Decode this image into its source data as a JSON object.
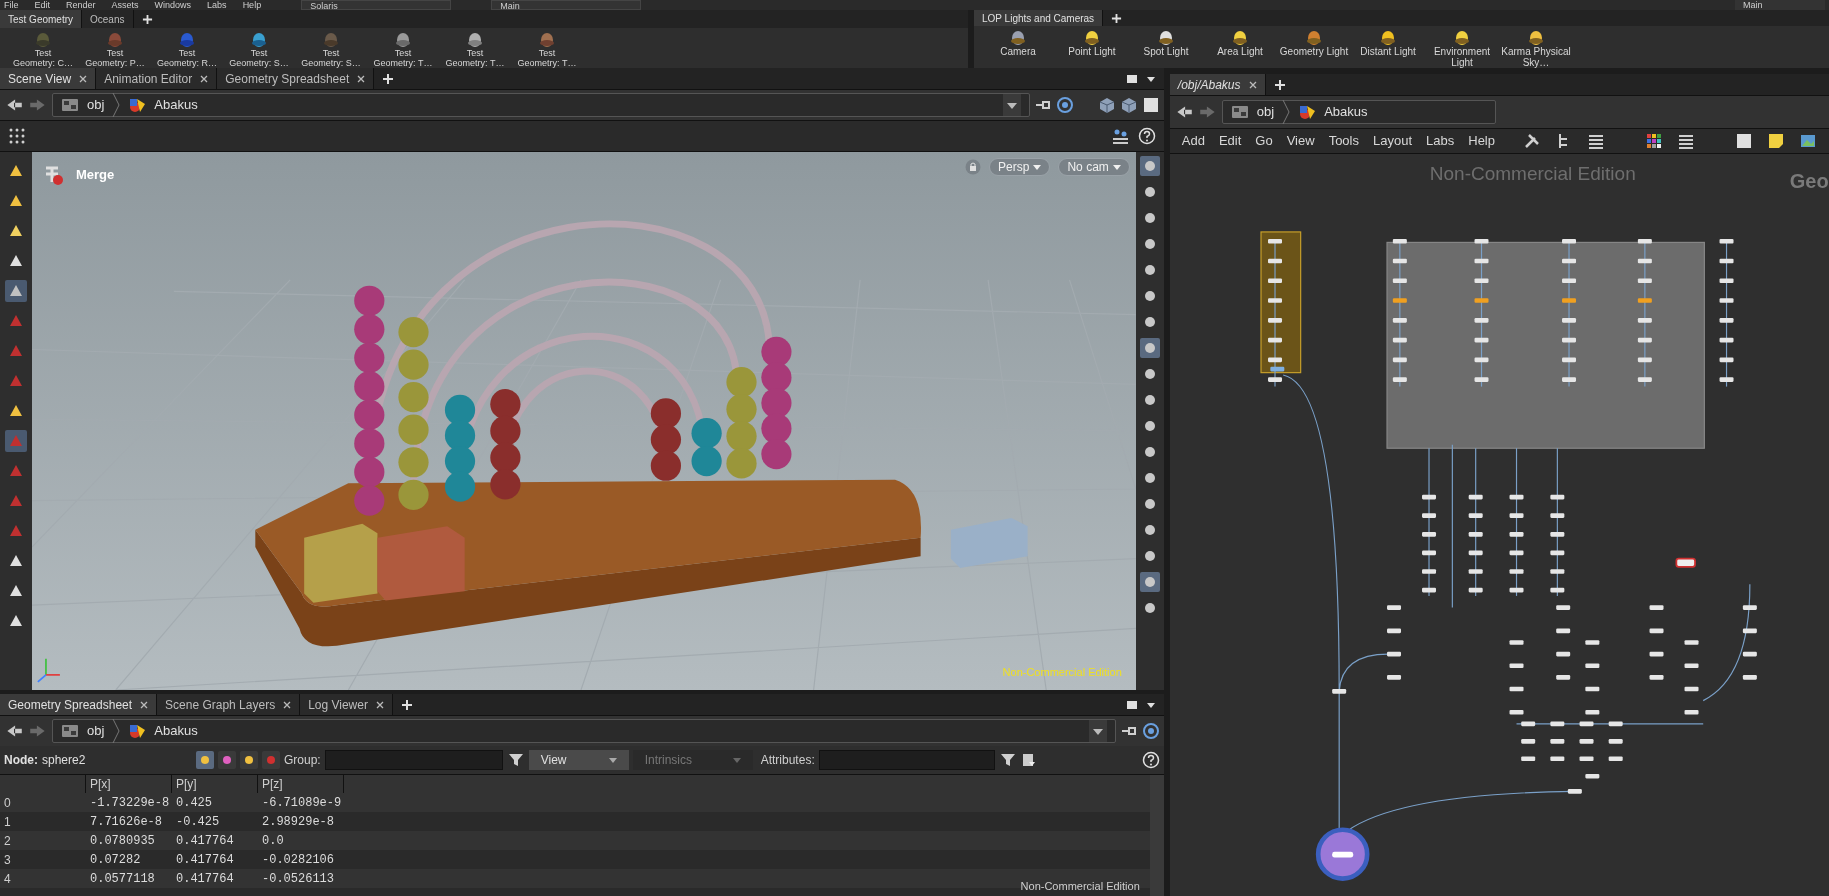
{
  "menu_bar": {
    "items": [
      "File",
      "Edit",
      "Render",
      "Assets",
      "Windows",
      "Labs",
      "Help"
    ],
    "desktops": [
      "Solaris",
      "Main"
    ],
    "corner_desktop": "Main"
  },
  "shelves": [
    {
      "tabs": [
        {
          "label": "Test Geometry",
          "selected": true
        },
        {
          "label": "Oceans",
          "selected": false
        }
      ],
      "tools": [
        "Test Geometry: C…",
        "Test Geometry: P…",
        "Test Geometry: R…",
        "Test Geometry: S…",
        "Test Geometry: S…",
        "Test Geometry: T…",
        "Test Geometry: T…",
        "Test Geometry: T…"
      ]
    },
    {
      "tabs": [
        {
          "label": "LOP Lights and Cameras",
          "selected": true
        }
      ],
      "tools": [
        "Camera",
        "Point Light",
        "Spot Light",
        "Area Light",
        "Geometry Light",
        "Distant Light",
        "Environment Light",
        "Karma Physical Sky…"
      ]
    }
  ],
  "scene_view": {
    "tabs": [
      {
        "label": "Scene View",
        "selected": true
      },
      {
        "label": "Animation Editor",
        "selected": false
      },
      {
        "label": "Geometry Spreadsheet",
        "selected": false
      }
    ],
    "path": [
      "obj",
      "Abakus"
    ],
    "node_label": "Merge",
    "view_menu": "Persp",
    "camera_menu": "No cam",
    "edition": "Non-Commercial Edition"
  },
  "spreadsheet": {
    "tabs": [
      {
        "label": "Geometry Spreadsheet",
        "selected": true
      },
      {
        "label": "Scene Graph Layers",
        "selected": false
      },
      {
        "label": "Log Viewer",
        "selected": false
      }
    ],
    "path": [
      "obj",
      "Abakus"
    ],
    "node_label": "Node:",
    "node": "sphere2",
    "group_label": "Group:",
    "view_menu": "View",
    "intrinsics_menu": "Intrinsics",
    "attributes_label": "Attributes:",
    "columns": [
      "P[x]",
      "P[y]",
      "P[z]"
    ],
    "rows": [
      {
        "index": "0",
        "values": [
          "-1.73229e-8",
          "0.425",
          "-6.71089e-9"
        ]
      },
      {
        "index": "1",
        "values": [
          "7.71626e-8",
          "-0.425",
          "2.98929e-8"
        ]
      },
      {
        "index": "2",
        "values": [
          "0.0780935",
          "0.417764",
          "0.0"
        ]
      },
      {
        "index": "3",
        "values": [
          "0.07282",
          "0.417764",
          "-0.0282106"
        ]
      },
      {
        "index": "4",
        "values": [
          "0.0577118",
          "0.417764",
          "-0.0526113"
        ]
      }
    ],
    "edition": "Non-Commercial Edition"
  },
  "network": {
    "tabs": [
      {
        "label": "/obj/Abakus",
        "selected": true
      }
    ],
    "path": [
      "obj",
      "Abakus"
    ],
    "menu": [
      "Add",
      "Edit",
      "Go",
      "View",
      "Tools",
      "Layout",
      "Labs",
      "Help"
    ],
    "edition": "Non-Commercial Edition",
    "context": "Geo"
  }
}
